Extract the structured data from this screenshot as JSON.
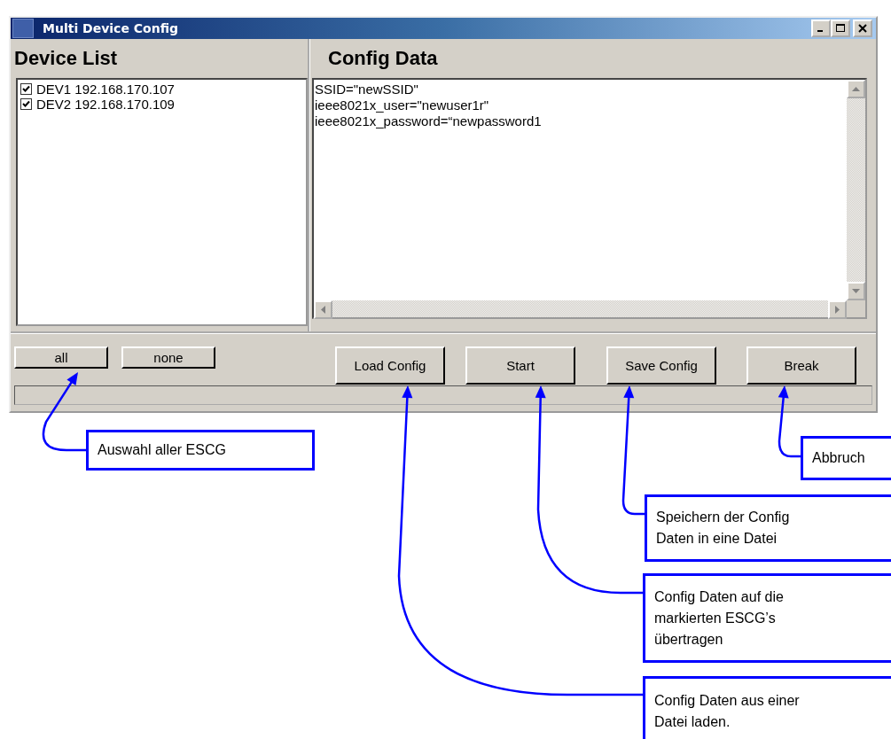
{
  "window": {
    "title": "Multi Device Config"
  },
  "device_list": {
    "heading": "Device List",
    "items": [
      {
        "label": "DEV1 192.168.170.107",
        "checked": true
      },
      {
        "label": "DEV2 192.168.170.109",
        "checked": true
      }
    ]
  },
  "config": {
    "heading": "Config Data",
    "lines": [
      "SSID=\"newSSID\"",
      "ieee8021x_user=\"newuser1r\"",
      "ieee8021x_password=“newpassword1"
    ]
  },
  "buttons": [
    {
      "label": "all",
      "kind": "small"
    },
    {
      "label": "none",
      "kind": "small"
    },
    {
      "label": "Load Config",
      "kind": "large"
    },
    {
      "label": "Start",
      "kind": "large"
    },
    {
      "label": "Save Config",
      "kind": "large"
    },
    {
      "label": "Break",
      "kind": "large"
    }
  ],
  "callouts": [
    {
      "text": "Auswahl aller ESCG"
    },
    {
      "text": "Abbruch"
    },
    {
      "text": "Speichern der Config\nDaten in eine Datei"
    },
    {
      "text": "Config Daten auf die\nmarkierten ESCG’s\nübertragen"
    },
    {
      "text": "Config Daten aus einer\nDatei laden."
    }
  ]
}
